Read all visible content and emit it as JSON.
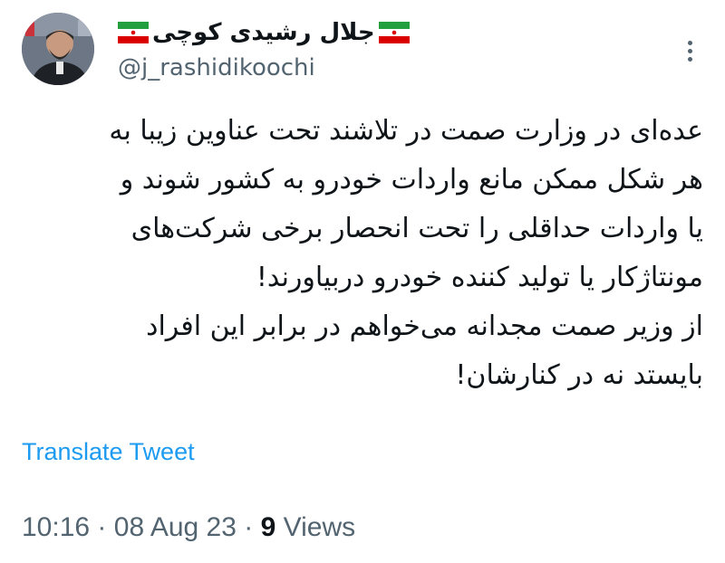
{
  "tweet": {
    "author": {
      "display_name": "جلال رشیدی کوچی",
      "handle": "@j_rashidikoochi",
      "flag_icon": "iran-flag-icon"
    },
    "body_lines": [
      "عده‌ای در وزارت صمت در تلاشند تحت عناوین زیبا به",
      "هر شکل ممکن مانع واردات خودرو به کشور شوند و",
      "یا واردات حداقلی را تحت انحصار برخی شرکت‌های",
      "مونتاژکار یا تولید کننده خودرو دربیاورند!",
      "از وزیر صمت مجدانه می‌خواهم در برابر این افراد",
      "بایستد نه در کنارشان!"
    ],
    "translate_label": "Translate Tweet",
    "time": "10:16",
    "separator": "·",
    "date": "08 Aug 23",
    "views_count": "9",
    "views_label": "Views"
  },
  "colors": {
    "accent": "#1d9bf0",
    "text_primary": "#0f1419",
    "text_secondary": "#536471",
    "flag_green": "#239f40",
    "flag_white": "#ffffff",
    "flag_red": "#da0000"
  }
}
